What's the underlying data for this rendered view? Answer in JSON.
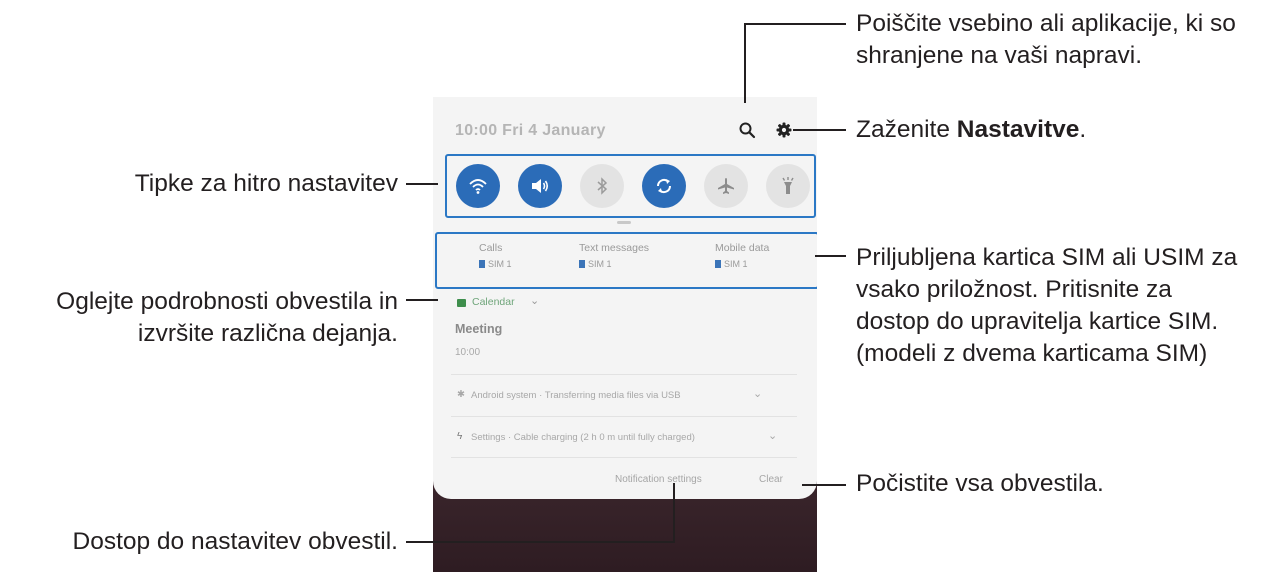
{
  "phone": {
    "status_time": "10:00  Fri 4 January",
    "sim_cards": [
      {
        "label": "Calls",
        "sim": "SIM 1"
      },
      {
        "label": "Text messages",
        "sim": "SIM 1"
      },
      {
        "label": "Mobile data",
        "sim": "SIM 1"
      }
    ],
    "notification": {
      "app": "Calendar",
      "title": "Meeting",
      "time": "10:00"
    },
    "system_rows": [
      "Android system · Transferring media files via USB",
      "Settings · Cable charging (2 h 0 m until fully charged)"
    ],
    "footer": {
      "settings_label": "Notification settings",
      "clear_label": "Clear"
    }
  },
  "quick_settings": [
    {
      "icon": "wifi-icon",
      "state": "on"
    },
    {
      "icon": "sound-icon",
      "state": "on"
    },
    {
      "icon": "bluetooth-icon",
      "state": "off"
    },
    {
      "icon": "auto-rotate-icon",
      "state": "on"
    },
    {
      "icon": "airplane-icon",
      "state": "off"
    },
    {
      "icon": "flashlight-icon",
      "state": "off"
    }
  ],
  "callouts": {
    "search_line1": "Poiščite vsebino ali aplikacije, ki so",
    "search_line2": "shranjene na vaši napravi.",
    "settings_prefix": "Zaženite ",
    "settings_bold": "Nastavitve",
    "settings_suffix": ".",
    "quick_buttons": "Tipke za hitro nastavitev",
    "notif_line1": "Oglejte podrobnosti obvestila in",
    "notif_line2": "izvršite različna dejanja.",
    "sim_line1": "Priljubljena kartica SIM ali USIM za",
    "sim_line2": "vsako priložnost. Pritisnite za",
    "sim_line3": "dostop do upravitelja kartice SIM.",
    "sim_line4": "(modeli z dvema karticama SIM)",
    "clear_all": "Počistite vsa obvestila.",
    "notif_settings": "Dostop do nastavitev obvestil."
  },
  "colors": {
    "accent": "#2b78c5",
    "qs_on": "#2b6cb8",
    "qs_off": "#e3e3e3",
    "wallpaper": "#4a3138"
  }
}
